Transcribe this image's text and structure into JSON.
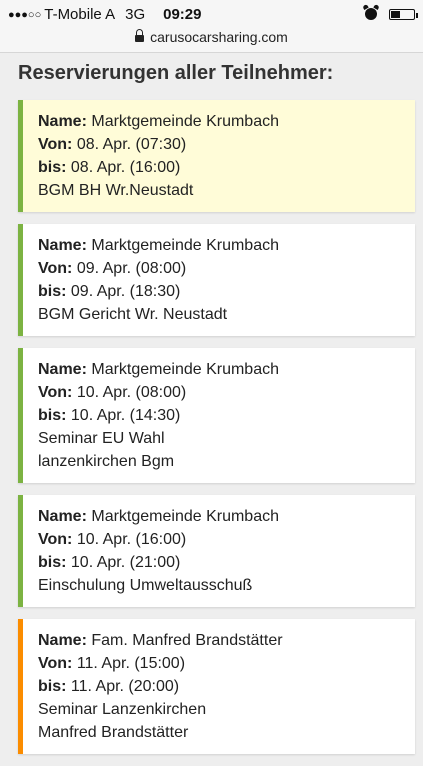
{
  "status_bar": {
    "signal_dots": "●●●○○",
    "carrier": "T-Mobile A",
    "network": "3G",
    "time": "09:29",
    "url": "carusocarsharing.com"
  },
  "heading": "Reservierungen aller Teilnehmer:",
  "labels": {
    "name": "Name:",
    "von": "Von:",
    "bis": "bis:"
  },
  "colors": {
    "green_accent": "#7cb342",
    "orange_accent": "#fb8c00",
    "highlight_bg": "#fffcd8"
  },
  "reservations": [
    {
      "name": "Marktgemeinde Krumbach",
      "von": "08. Apr. (07:30)",
      "bis": "08. Apr. (16:00)",
      "note": "BGM BH Wr.Neustadt"
    },
    {
      "name": "Marktgemeinde Krumbach",
      "von": "09. Apr. (08:00)",
      "bis": "09. Apr. (18:30)",
      "note": "BGM Gericht Wr. Neustadt"
    },
    {
      "name": "Marktgemeinde Krumbach",
      "von": "10. Apr. (08:00)",
      "bis": "10. Apr. (14:30)",
      "note": "Seminar EU Wahl",
      "note2": "lanzenkirchen Bgm"
    },
    {
      "name": "Marktgemeinde Krumbach",
      "von": "10. Apr. (16:00)",
      "bis": "10. Apr. (21:00)",
      "note": "Einschulung Umweltausschuß"
    },
    {
      "name": "Fam. Manfred Brandstätter",
      "von": "11. Apr. (15:00)",
      "bis": "11. Apr. (20:00)",
      "note": "Seminar Lanzenkirchen",
      "note2": "Manfred Brandstätter"
    }
  ]
}
